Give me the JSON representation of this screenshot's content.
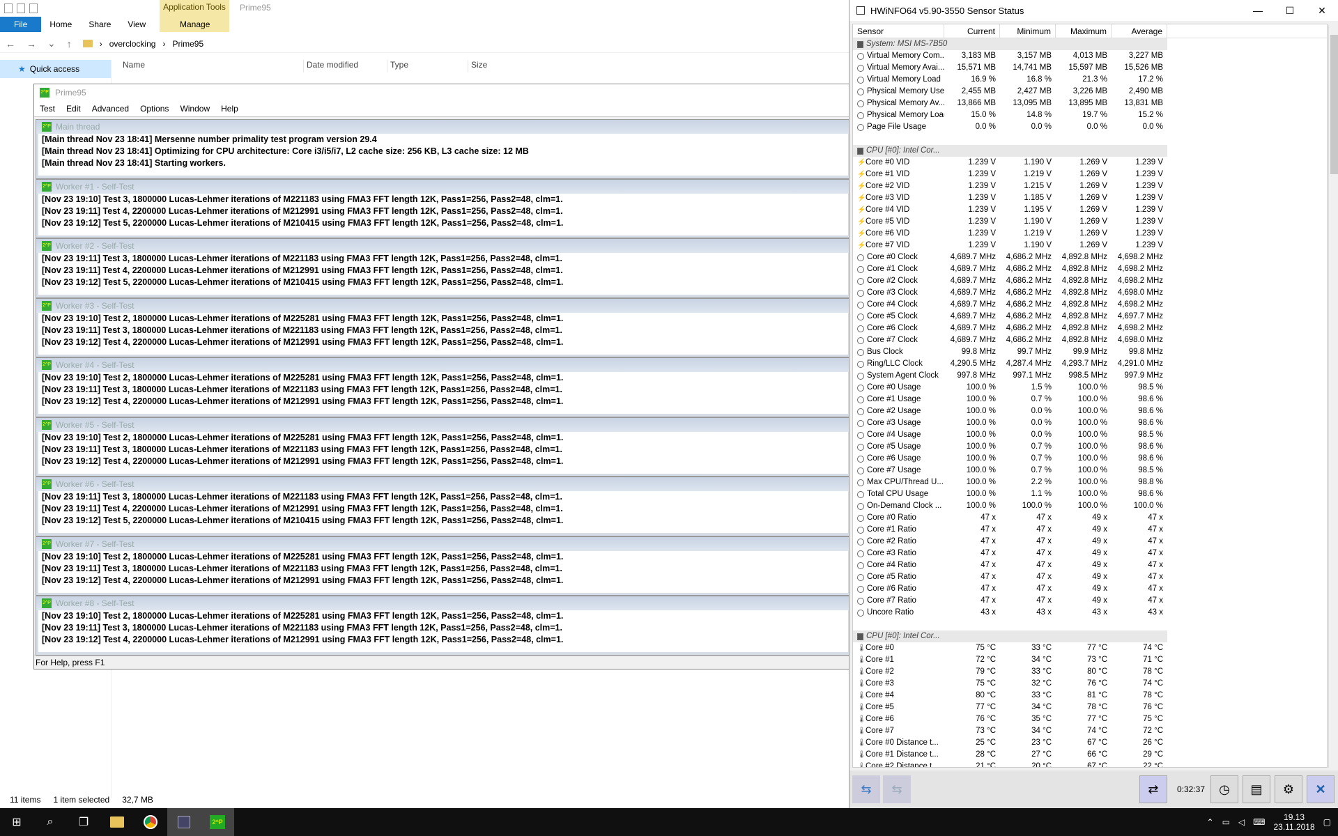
{
  "explorer": {
    "ctx_tab": "Application Tools",
    "ctx_title": "Prime95",
    "tabs": [
      "File",
      "Home",
      "Share",
      "View"
    ],
    "manage": "Manage",
    "breadcrumb": [
      "overclocking",
      "Prime95"
    ],
    "quick_access": "Quick access",
    "columns": [
      "Name",
      "Date modified",
      "Type",
      "Size"
    ],
    "status": {
      "items": "11 items",
      "selected": "1 item selected",
      "size": "32,7 MB"
    }
  },
  "prime": {
    "title": "Prime95",
    "menu": [
      "Test",
      "Edit",
      "Advanced",
      "Options",
      "Window",
      "Help"
    ],
    "status": "For Help, press F1",
    "windows": [
      {
        "title": "Main thread",
        "lines": [
          "[Main thread Nov 23 18:41] Mersenne number primality test program version 29.4",
          "[Main thread Nov 23 18:41] Optimizing for CPU architecture: Core i3/i5/i7, L2 cache size: 256 KB, L3 cache size: 12 MB",
          "[Main thread Nov 23 18:41] Starting workers."
        ]
      },
      {
        "title": "Worker #1 - Self-Test",
        "lines": [
          "[Nov 23 19:10] Test 3, 1800000 Lucas-Lehmer iterations of M221183 using FMA3 FFT length 12K, Pass1=256, Pass2=48, clm=1.",
          "[Nov 23 19:11] Test 4, 2200000 Lucas-Lehmer iterations of M212991 using FMA3 FFT length 12K, Pass1=256, Pass2=48, clm=1.",
          "[Nov 23 19:12] Test 5, 2200000 Lucas-Lehmer iterations of M210415 using FMA3 FFT length 12K, Pass1=256, Pass2=48, clm=1."
        ]
      },
      {
        "title": "Worker #2 - Self-Test",
        "lines": [
          "[Nov 23 19:11] Test 3, 1800000 Lucas-Lehmer iterations of M221183 using FMA3 FFT length 12K, Pass1=256, Pass2=48, clm=1.",
          "[Nov 23 19:11] Test 4, 2200000 Lucas-Lehmer iterations of M212991 using FMA3 FFT length 12K, Pass1=256, Pass2=48, clm=1.",
          "[Nov 23 19:12] Test 5, 2200000 Lucas-Lehmer iterations of M210415 using FMA3 FFT length 12K, Pass1=256, Pass2=48, clm=1."
        ]
      },
      {
        "title": "Worker #3 - Self-Test",
        "lines": [
          "[Nov 23 19:10] Test 2, 1800000 Lucas-Lehmer iterations of M225281 using FMA3 FFT length 12K, Pass1=256, Pass2=48, clm=1.",
          "[Nov 23 19:11] Test 3, 1800000 Lucas-Lehmer iterations of M221183 using FMA3 FFT length 12K, Pass1=256, Pass2=48, clm=1.",
          "[Nov 23 19:12] Test 4, 2200000 Lucas-Lehmer iterations of M212991 using FMA3 FFT length 12K, Pass1=256, Pass2=48, clm=1."
        ]
      },
      {
        "title": "Worker #4 - Self-Test",
        "lines": [
          "[Nov 23 19:10] Test 2, 1800000 Lucas-Lehmer iterations of M225281 using FMA3 FFT length 12K, Pass1=256, Pass2=48, clm=1.",
          "[Nov 23 19:11] Test 3, 1800000 Lucas-Lehmer iterations of M221183 using FMA3 FFT length 12K, Pass1=256, Pass2=48, clm=1.",
          "[Nov 23 19:12] Test 4, 2200000 Lucas-Lehmer iterations of M212991 using FMA3 FFT length 12K, Pass1=256, Pass2=48, clm=1."
        ]
      },
      {
        "title": "Worker #5 - Self-Test",
        "lines": [
          "[Nov 23 19:10] Test 2, 1800000 Lucas-Lehmer iterations of M225281 using FMA3 FFT length 12K, Pass1=256, Pass2=48, clm=1.",
          "[Nov 23 19:11] Test 3, 1800000 Lucas-Lehmer iterations of M221183 using FMA3 FFT length 12K, Pass1=256, Pass2=48, clm=1.",
          "[Nov 23 19:12] Test 4, 2200000 Lucas-Lehmer iterations of M212991 using FMA3 FFT length 12K, Pass1=256, Pass2=48, clm=1."
        ]
      },
      {
        "title": "Worker #6 - Self-Test",
        "lines": [
          "[Nov 23 19:11] Test 3, 1800000 Lucas-Lehmer iterations of M221183 using FMA3 FFT length 12K, Pass1=256, Pass2=48, clm=1.",
          "[Nov 23 19:11] Test 4, 2200000 Lucas-Lehmer iterations of M212991 using FMA3 FFT length 12K, Pass1=256, Pass2=48, clm=1.",
          "[Nov 23 19:12] Test 5, 2200000 Lucas-Lehmer iterations of M210415 using FMA3 FFT length 12K, Pass1=256, Pass2=48, clm=1."
        ]
      },
      {
        "title": "Worker #7 - Self-Test",
        "lines": [
          "[Nov 23 19:10] Test 2, 1800000 Lucas-Lehmer iterations of M225281 using FMA3 FFT length 12K, Pass1=256, Pass2=48, clm=1.",
          "[Nov 23 19:11] Test 3, 1800000 Lucas-Lehmer iterations of M221183 using FMA3 FFT length 12K, Pass1=256, Pass2=48, clm=1.",
          "[Nov 23 19:12] Test 4, 2200000 Lucas-Lehmer iterations of M212991 using FMA3 FFT length 12K, Pass1=256, Pass2=48, clm=1."
        ]
      },
      {
        "title": "Worker #8 - Self-Test",
        "lines": [
          "[Nov 23 19:10] Test 2, 1800000 Lucas-Lehmer iterations of M225281 using FMA3 FFT length 12K, Pass1=256, Pass2=48, clm=1.",
          "[Nov 23 19:11] Test 3, 1800000 Lucas-Lehmer iterations of M221183 using FMA3 FFT length 12K, Pass1=256, Pass2=48, clm=1.",
          "[Nov 23 19:12] Test 4, 2200000 Lucas-Lehmer iterations of M212991 using FMA3 FFT length 12K, Pass1=256, Pass2=48, clm=1."
        ]
      }
    ]
  },
  "hwinfo": {
    "title": "HWiNFO64 v5.90-3550 Sensor Status",
    "headers": [
      "Sensor",
      "Current",
      "Minimum",
      "Maximum",
      "Average"
    ],
    "timer": "0:32:37",
    "rows": [
      {
        "g": "System: MSI MS-7B50"
      },
      {
        "i": "c",
        "n": "Virtual Memory Com...",
        "v": [
          "3,183 MB",
          "3,157 MB",
          "4,013 MB",
          "3,227 MB"
        ]
      },
      {
        "i": "c",
        "n": "Virtual Memory Avai...",
        "v": [
          "15,571 MB",
          "14,741 MB",
          "15,597 MB",
          "15,526 MB"
        ]
      },
      {
        "i": "c",
        "n": "Virtual Memory Load",
        "v": [
          "16.9 %",
          "16.8 %",
          "21.3 %",
          "17.2 %"
        ]
      },
      {
        "i": "c",
        "n": "Physical Memory Used",
        "v": [
          "2,455 MB",
          "2,427 MB",
          "3,226 MB",
          "2,490 MB"
        ]
      },
      {
        "i": "c",
        "n": "Physical Memory Av...",
        "v": [
          "13,866 MB",
          "13,095 MB",
          "13,895 MB",
          "13,831 MB"
        ]
      },
      {
        "i": "c",
        "n": "Physical Memory Load",
        "v": [
          "15.0 %",
          "14.8 %",
          "19.7 %",
          "15.2 %"
        ]
      },
      {
        "i": "c",
        "n": "Page File Usage",
        "v": [
          "0.0 %",
          "0.0 %",
          "0.0 %",
          "0.0 %"
        ]
      },
      {
        "blank": true
      },
      {
        "g": "CPU [#0]: Intel Cor..."
      },
      {
        "i": "b",
        "n": "Core #0 VID",
        "v": [
          "1.239 V",
          "1.190 V",
          "1.269 V",
          "1.239 V"
        ]
      },
      {
        "i": "b",
        "n": "Core #1 VID",
        "v": [
          "1.239 V",
          "1.219 V",
          "1.269 V",
          "1.239 V"
        ]
      },
      {
        "i": "b",
        "n": "Core #2 VID",
        "v": [
          "1.239 V",
          "1.215 V",
          "1.269 V",
          "1.239 V"
        ]
      },
      {
        "i": "b",
        "n": "Core #3 VID",
        "v": [
          "1.239 V",
          "1.185 V",
          "1.269 V",
          "1.239 V"
        ]
      },
      {
        "i": "b",
        "n": "Core #4 VID",
        "v": [
          "1.239 V",
          "1.195 V",
          "1.269 V",
          "1.239 V"
        ]
      },
      {
        "i": "b",
        "n": "Core #5 VID",
        "v": [
          "1.239 V",
          "1.190 V",
          "1.269 V",
          "1.239 V"
        ]
      },
      {
        "i": "b",
        "n": "Core #6 VID",
        "v": [
          "1.239 V",
          "1.219 V",
          "1.269 V",
          "1.239 V"
        ]
      },
      {
        "i": "b",
        "n": "Core #7 VID",
        "v": [
          "1.239 V",
          "1.190 V",
          "1.269 V",
          "1.239 V"
        ]
      },
      {
        "i": "c",
        "n": "Core #0 Clock",
        "v": [
          "4,689.7 MHz",
          "4,686.2 MHz",
          "4,892.8 MHz",
          "4,698.2 MHz"
        ]
      },
      {
        "i": "c",
        "n": "Core #1 Clock",
        "v": [
          "4,689.7 MHz",
          "4,686.2 MHz",
          "4,892.8 MHz",
          "4,698.2 MHz"
        ]
      },
      {
        "i": "c",
        "n": "Core #2 Clock",
        "v": [
          "4,689.7 MHz",
          "4,686.2 MHz",
          "4,892.8 MHz",
          "4,698.2 MHz"
        ]
      },
      {
        "i": "c",
        "n": "Core #3 Clock",
        "v": [
          "4,689.7 MHz",
          "4,686.2 MHz",
          "4,892.8 MHz",
          "4,698.0 MHz"
        ]
      },
      {
        "i": "c",
        "n": "Core #4 Clock",
        "v": [
          "4,689.7 MHz",
          "4,686.2 MHz",
          "4,892.8 MHz",
          "4,698.2 MHz"
        ]
      },
      {
        "i": "c",
        "n": "Core #5 Clock",
        "v": [
          "4,689.7 MHz",
          "4,686.2 MHz",
          "4,892.8 MHz",
          "4,697.7 MHz"
        ]
      },
      {
        "i": "c",
        "n": "Core #6 Clock",
        "v": [
          "4,689.7 MHz",
          "4,686.2 MHz",
          "4,892.8 MHz",
          "4,698.2 MHz"
        ]
      },
      {
        "i": "c",
        "n": "Core #7 Clock",
        "v": [
          "4,689.7 MHz",
          "4,686.2 MHz",
          "4,892.8 MHz",
          "4,698.0 MHz"
        ]
      },
      {
        "i": "c",
        "n": "Bus Clock",
        "v": [
          "99.8 MHz",
          "99.7 MHz",
          "99.9 MHz",
          "99.8 MHz"
        ]
      },
      {
        "i": "c",
        "n": "Ring/LLC Clock",
        "v": [
          "4,290.5 MHz",
          "4,287.4 MHz",
          "4,293.7 MHz",
          "4,291.0 MHz"
        ]
      },
      {
        "i": "c",
        "n": "System Agent Clock",
        "v": [
          "997.8 MHz",
          "997.1 MHz",
          "998.5 MHz",
          "997.9 MHz"
        ]
      },
      {
        "i": "c",
        "n": "Core #0 Usage",
        "v": [
          "100.0 %",
          "1.5 %",
          "100.0 %",
          "98.5 %"
        ]
      },
      {
        "i": "c",
        "n": "Core #1 Usage",
        "v": [
          "100.0 %",
          "0.7 %",
          "100.0 %",
          "98.6 %"
        ]
      },
      {
        "i": "c",
        "n": "Core #2 Usage",
        "v": [
          "100.0 %",
          "0.0 %",
          "100.0 %",
          "98.6 %"
        ]
      },
      {
        "i": "c",
        "n": "Core #3 Usage",
        "v": [
          "100.0 %",
          "0.0 %",
          "100.0 %",
          "98.6 %"
        ]
      },
      {
        "i": "c",
        "n": "Core #4 Usage",
        "v": [
          "100.0 %",
          "0.0 %",
          "100.0 %",
          "98.5 %"
        ]
      },
      {
        "i": "c",
        "n": "Core #5 Usage",
        "v": [
          "100.0 %",
          "0.7 %",
          "100.0 %",
          "98.6 %"
        ]
      },
      {
        "i": "c",
        "n": "Core #6 Usage",
        "v": [
          "100.0 %",
          "0.7 %",
          "100.0 %",
          "98.6 %"
        ]
      },
      {
        "i": "c",
        "n": "Core #7 Usage",
        "v": [
          "100.0 %",
          "0.7 %",
          "100.0 %",
          "98.5 %"
        ]
      },
      {
        "i": "c",
        "n": "Max CPU/Thread U...",
        "v": [
          "100.0 %",
          "2.2 %",
          "100.0 %",
          "98.8 %"
        ]
      },
      {
        "i": "c",
        "n": "Total CPU Usage",
        "v": [
          "100.0 %",
          "1.1 %",
          "100.0 %",
          "98.6 %"
        ]
      },
      {
        "i": "c",
        "n": "On-Demand Clock ...",
        "v": [
          "100.0 %",
          "100.0 %",
          "100.0 %",
          "100.0 %"
        ]
      },
      {
        "i": "c",
        "n": "Core #0 Ratio",
        "v": [
          "47 x",
          "47 x",
          "49 x",
          "47 x"
        ]
      },
      {
        "i": "c",
        "n": "Core #1 Ratio",
        "v": [
          "47 x",
          "47 x",
          "49 x",
          "47 x"
        ]
      },
      {
        "i": "c",
        "n": "Core #2 Ratio",
        "v": [
          "47 x",
          "47 x",
          "49 x",
          "47 x"
        ]
      },
      {
        "i": "c",
        "n": "Core #3 Ratio",
        "v": [
          "47 x",
          "47 x",
          "49 x",
          "47 x"
        ]
      },
      {
        "i": "c",
        "n": "Core #4 Ratio",
        "v": [
          "47 x",
          "47 x",
          "49 x",
          "47 x"
        ]
      },
      {
        "i": "c",
        "n": "Core #5 Ratio",
        "v": [
          "47 x",
          "47 x",
          "49 x",
          "47 x"
        ]
      },
      {
        "i": "c",
        "n": "Core #6 Ratio",
        "v": [
          "47 x",
          "47 x",
          "49 x",
          "47 x"
        ]
      },
      {
        "i": "c",
        "n": "Core #7 Ratio",
        "v": [
          "47 x",
          "47 x",
          "49 x",
          "47 x"
        ]
      },
      {
        "i": "c",
        "n": "Uncore Ratio",
        "v": [
          "43 x",
          "43 x",
          "43 x",
          "43 x"
        ]
      },
      {
        "blank": true
      },
      {
        "g": "CPU [#0]: Intel Cor..."
      },
      {
        "i": "t",
        "n": "Core #0",
        "v": [
          "75 °C",
          "33 °C",
          "77 °C",
          "74 °C"
        ]
      },
      {
        "i": "t",
        "n": "Core #1",
        "v": [
          "72 °C",
          "34 °C",
          "73 °C",
          "71 °C"
        ]
      },
      {
        "i": "t",
        "n": "Core #2",
        "v": [
          "79 °C",
          "33 °C",
          "80 °C",
          "78 °C"
        ]
      },
      {
        "i": "t",
        "n": "Core #3",
        "v": [
          "75 °C",
          "32 °C",
          "76 °C",
          "74 °C"
        ]
      },
      {
        "i": "t",
        "n": "Core #4",
        "v": [
          "80 °C",
          "33 °C",
          "81 °C",
          "78 °C"
        ]
      },
      {
        "i": "t",
        "n": "Core #5",
        "v": [
          "77 °C",
          "34 °C",
          "78 °C",
          "76 °C"
        ]
      },
      {
        "i": "t",
        "n": "Core #6",
        "v": [
          "76 °C",
          "35 °C",
          "77 °C",
          "75 °C"
        ]
      },
      {
        "i": "t",
        "n": "Core #7",
        "v": [
          "73 °C",
          "34 °C",
          "74 °C",
          "72 °C"
        ]
      },
      {
        "i": "t",
        "n": "Core #0 Distance t...",
        "v": [
          "25 °C",
          "23 °C",
          "67 °C",
          "26 °C"
        ]
      },
      {
        "i": "t",
        "n": "Core #1 Distance t...",
        "v": [
          "28 °C",
          "27 °C",
          "66 °C",
          "29 °C"
        ]
      },
      {
        "i": "t",
        "n": "Core #2 Distance t...",
        "v": [
          "21 °C",
          "20 °C",
          "67 °C",
          "22 °C"
        ]
      }
    ]
  },
  "taskbar": {
    "time": "19.13",
    "date": "23.11.2018"
  }
}
